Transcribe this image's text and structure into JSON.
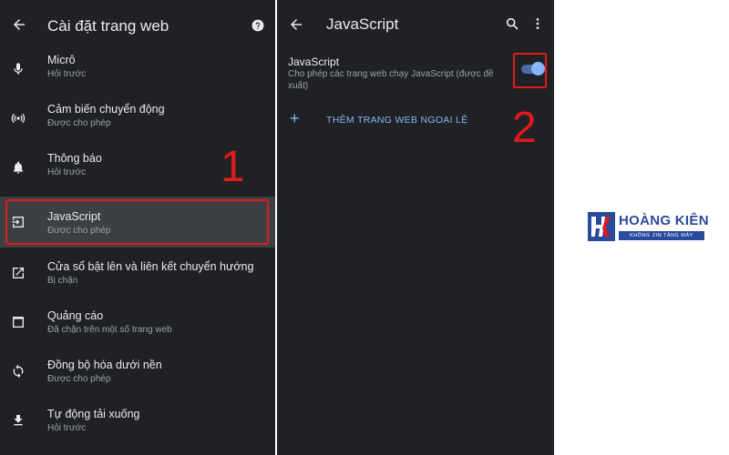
{
  "left": {
    "title": "Cài đặt trang web",
    "items": [
      {
        "title": "Micrô",
        "subtitle": "Hỏi trước",
        "icon": "mic-icon"
      },
      {
        "title": "Cảm biến chuyển động",
        "subtitle": "Được cho phép",
        "icon": "sensors-icon"
      },
      {
        "title": "Thông báo",
        "subtitle": "Hỏi trước",
        "icon": "bell-icon"
      },
      {
        "title": "JavaScript",
        "subtitle": "Được cho phép",
        "icon": "javascript-icon"
      },
      {
        "title": "Cửa sổ bật lên và liên kết chuyển hướng",
        "subtitle": "Bị chặn",
        "icon": "popup-icon"
      },
      {
        "title": "Quảng cáo",
        "subtitle": "Đã chặn trên một số trang web",
        "icon": "ads-icon"
      },
      {
        "title": "Đồng bộ hóa dưới nền",
        "subtitle": "Được cho phép",
        "icon": "sync-icon"
      },
      {
        "title": "Tự động tải xuống",
        "subtitle": "Hỏi trước",
        "icon": "download-icon"
      }
    ]
  },
  "right": {
    "title": "JavaScript",
    "setting_title": "JavaScript",
    "setting_desc": "Cho phép các trang web chạy JavaScript (được đề xuất)",
    "toggle_on": true,
    "add_exception": "THÊM TRANG WEB NGOẠI LỆ"
  },
  "annotations": {
    "step1": "1",
    "step2": "2"
  },
  "logo": {
    "name": "HOÀNG KIÊN",
    "tagline": "KHÔNG ZIN TẶNG MÁY"
  },
  "colors": {
    "accent": "#8ab4f8",
    "highlight": "#e0191c",
    "brand": "#2a4a9c",
    "panel_bg": "#202124"
  }
}
